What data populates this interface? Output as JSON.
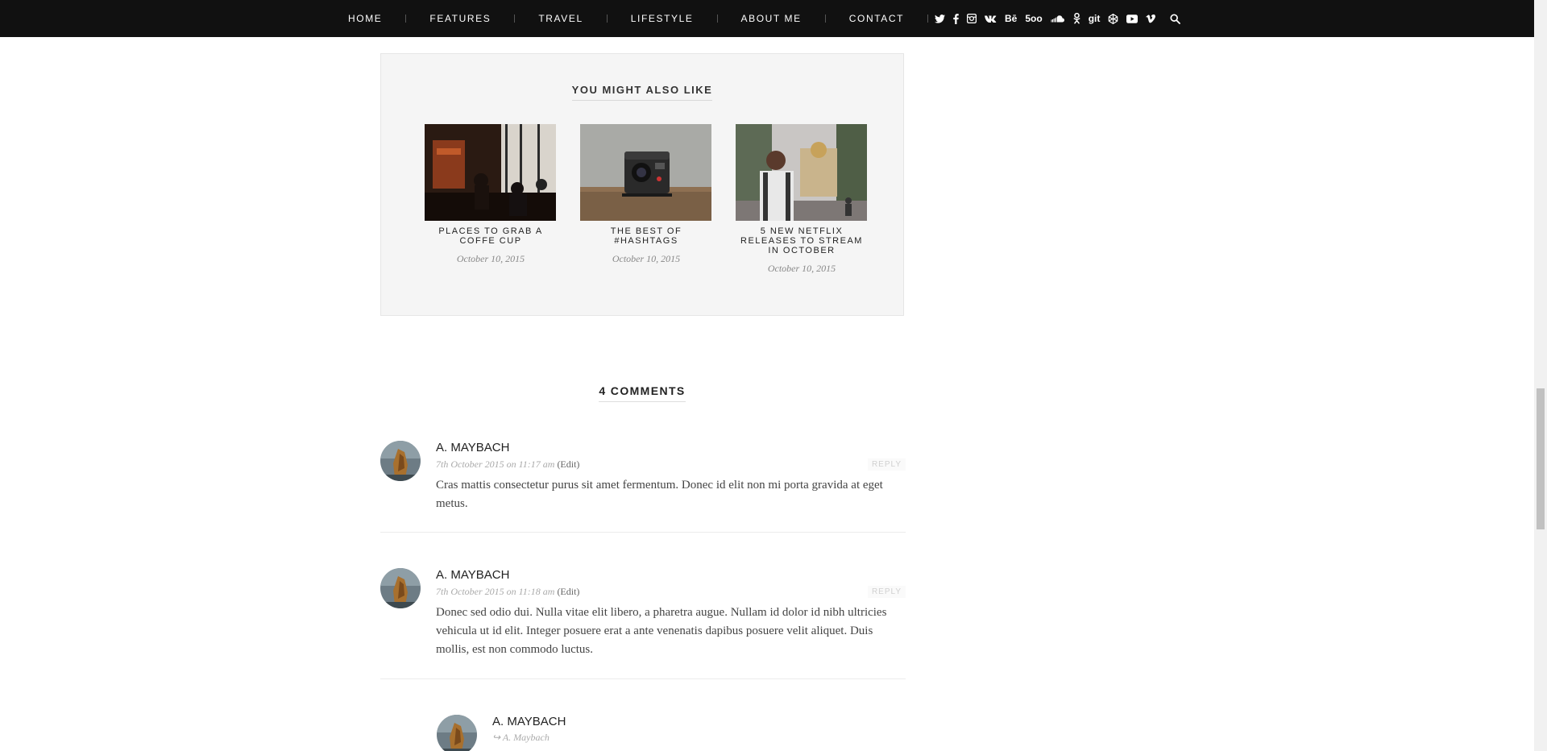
{
  "nav": {
    "items": [
      "HOME",
      "FEATURES",
      "TRAVEL",
      "LIFESTYLE",
      "ABOUT ME",
      "CONTACT"
    ]
  },
  "social": {
    "icons": [
      "twitter-icon",
      "facebook-icon",
      "instagram-icon",
      "vk-icon",
      "behance-icon",
      "500px-icon",
      "soundcloud-icon",
      "odnoklassniki-icon",
      "github-icon",
      "codepen-icon",
      "youtube-icon",
      "vimeo-icon",
      "search-icon"
    ],
    "behance_label": "Bē",
    "fivehundred_label": "5oo",
    "github_label": "git"
  },
  "related": {
    "title": "YOU MIGHT ALSO LIKE",
    "posts": [
      {
        "title": "PLACES TO GRAB A COFFE CUP",
        "date": "October 10, 2015"
      },
      {
        "title": "THE BEST OF #HASHTAGS",
        "date": "October 10, 2015"
      },
      {
        "title": "5 NEW NETFLIX RELEASES TO STREAM IN OCTOBER",
        "date": "October 10, 2015"
      }
    ]
  },
  "comments": {
    "title": "4 COMMENTS",
    "reply_label": "REPLY",
    "edit_label": "(Edit)",
    "items": [
      {
        "author": "A. MAYBACH",
        "meta": "7th October 2015 on 11:17 am",
        "text": "Cras mattis consectetur purus sit amet fermentum. Donec id elit non mi porta gravida at eget metus."
      },
      {
        "author": "A. MAYBACH",
        "meta": "7th October 2015 on 11:18 am",
        "text": "Donec sed odio dui. Nulla vitae elit libero, a pharetra augue. Nullam id dolor id nibh ultricies vehicula ut id elit. Integer posuere erat a ante venenatis dapibus posuere velit aliquet. Duis mollis, est non commodo luctus."
      },
      {
        "author": "A. MAYBACH",
        "reply_to": "A. Maybach"
      }
    ]
  }
}
